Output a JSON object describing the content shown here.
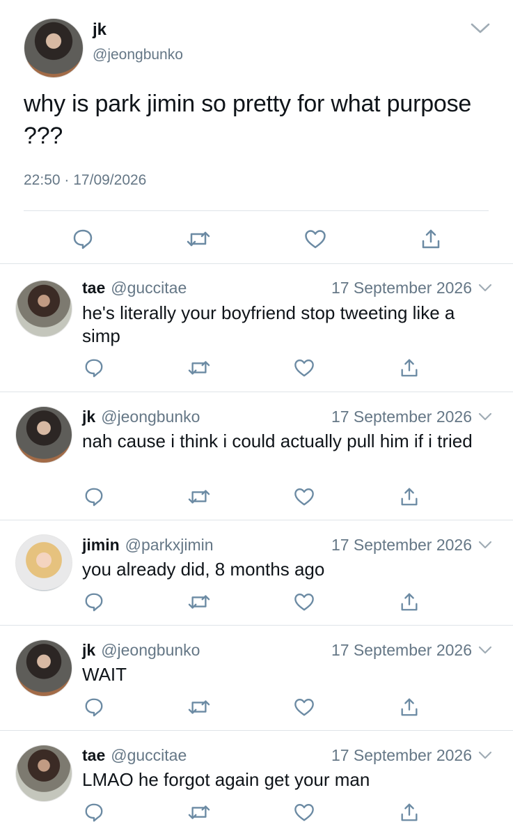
{
  "main_tweet": {
    "name": "jk",
    "handle": "@jeongbunko",
    "text": "why is park jimin so pretty for what purpose ???",
    "time": "22:50",
    "separator": "·",
    "date": "17/09/2026"
  },
  "replies": [
    {
      "name": "tae",
      "handle": "@guccitae",
      "date": "17 September 2026",
      "text": "he's literally your boyfriend stop tweeting like a simp"
    },
    {
      "name": "jk",
      "handle": "@jeongbunko",
      "date": "17 September 2026",
      "text": "nah cause i think i could actually pull him if i tried"
    },
    {
      "name": "jimin",
      "handle": "@parkxjimin",
      "date": "17 September 2026",
      "text": "you already did, 8 months ago"
    },
    {
      "name": "jk",
      "handle": "@jeongbunko",
      "date": "17 September 2026",
      "text": "WAIT"
    },
    {
      "name": "tae",
      "handle": "@guccitae",
      "date": "17 September 2026",
      "text": "LMAO he forgot again get your man"
    }
  ],
  "icons": {
    "reply": "reply-icon",
    "retweet": "retweet-icon",
    "like": "heart-icon",
    "share": "share-icon",
    "more": "chevron-down-icon"
  },
  "colors": {
    "text": "#0f1419",
    "secondary": "#657786",
    "icon": "#6b8aa3",
    "divider": "#dfe4e8"
  }
}
